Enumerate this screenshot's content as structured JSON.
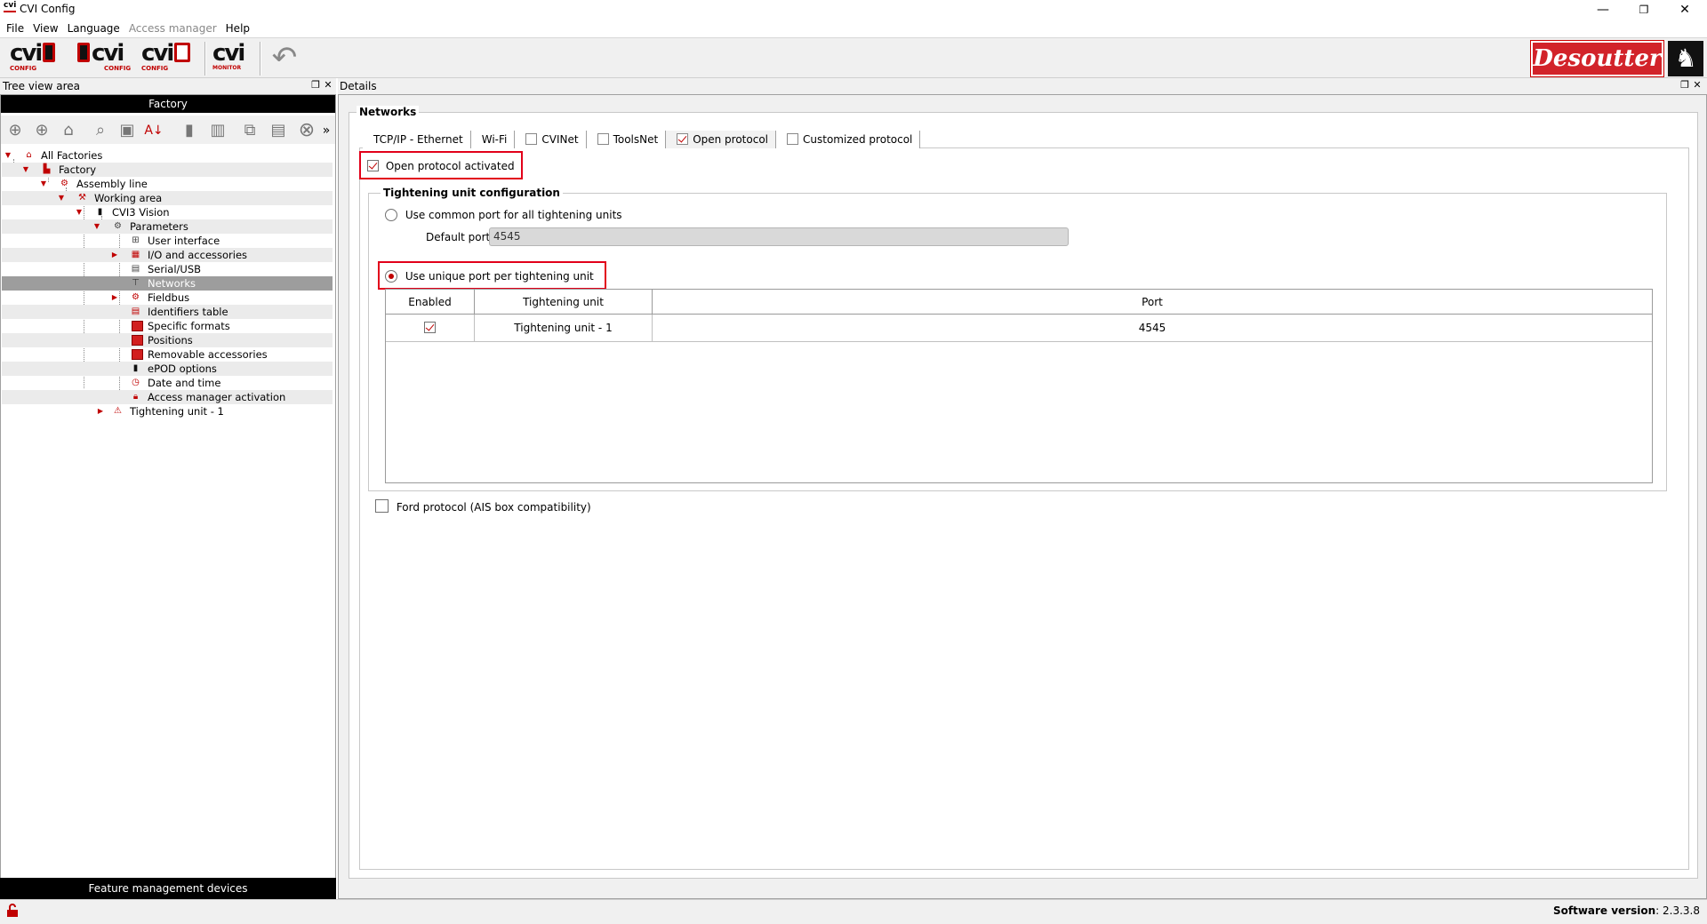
{
  "window": {
    "title": "CVI Config",
    "logo_text": "cvi",
    "minimize": "—",
    "restore": "❐",
    "close": "✕"
  },
  "menu": [
    "File",
    "View",
    "Language",
    "Access manager",
    "Help"
  ],
  "toolbar": {
    "cvi_config_label": "CONFIG",
    "cvi_monitor_label": "MONITOR",
    "cvi_text": "cvi",
    "undo": "↶"
  },
  "brand": {
    "name": "Desoutter",
    "horse": "♞"
  },
  "tree_panel": {
    "title": "Tree view area",
    "factory_bar": "Factory",
    "features_bar": "Feature management devices",
    "more": "»",
    "items": [
      {
        "label": "All Factories"
      },
      {
        "label": "Factory"
      },
      {
        "label": "Assembly line"
      },
      {
        "label": "Working area"
      },
      {
        "label": "CVI3 Vision"
      },
      {
        "label": "Parameters"
      },
      {
        "label": "User interface"
      },
      {
        "label": "I/O and accessories"
      },
      {
        "label": "Serial/USB"
      },
      {
        "label": "Networks"
      },
      {
        "label": "Fieldbus"
      },
      {
        "label": "Identifiers table"
      },
      {
        "label": "Specific formats"
      },
      {
        "label": "Positions"
      },
      {
        "label": "Removable accessories"
      },
      {
        "label": "ePOD options"
      },
      {
        "label": "Date and time"
      },
      {
        "label": "Access manager activation"
      },
      {
        "label": "Tightening unit - 1"
      }
    ]
  },
  "details": {
    "title": "Details",
    "section_title": "Networks",
    "tabs": [
      {
        "label": "TCP/IP - Ethernet",
        "has_checkbox": false,
        "checked": false
      },
      {
        "label": "Wi-Fi",
        "has_checkbox": false,
        "checked": false
      },
      {
        "label": "CVINet",
        "has_checkbox": true,
        "checked": false
      },
      {
        "label": "ToolsNet",
        "has_checkbox": true,
        "checked": false
      },
      {
        "label": "Open protocol",
        "has_checkbox": true,
        "checked": true
      },
      {
        "label": "Customized protocol",
        "has_checkbox": true,
        "checked": false
      }
    ],
    "open_protocol_activated": {
      "label": "Open protocol activated",
      "checked": true
    },
    "tightening_config": {
      "title": "Tightening unit configuration",
      "common_port_option": {
        "label": "Use common port for all tightening units",
        "selected": false
      },
      "default_port_label": "Default port",
      "default_port_value": "4545",
      "unique_port_option": {
        "label": "Use unique port per tightening unit",
        "selected": true
      },
      "table": {
        "headers": [
          "Enabled",
          "Tightening unit",
          "Port"
        ],
        "rows": [
          {
            "enabled": true,
            "unit": "Tightening unit - 1",
            "port": "4545"
          }
        ]
      }
    },
    "ford_protocol": {
      "label": "Ford protocol (AIS box compatibility)",
      "checked": false
    }
  },
  "status": {
    "version_label": "Software version",
    "version_value": ": 2.3.3.8"
  },
  "colors": {
    "accent_red": "#c00000",
    "highlight_box": "#e2001a",
    "selected_row": "#9d9d9d",
    "brand_red": "#d2232a"
  }
}
